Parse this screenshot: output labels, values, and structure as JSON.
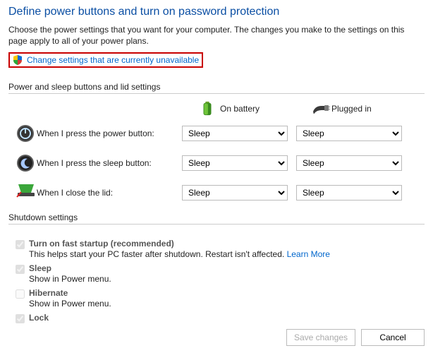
{
  "title": "Define power buttons and turn on password protection",
  "intro": "Choose the power settings that you want for your computer. The changes you make to the settings on this page apply to all of your power plans.",
  "change_link": "Change settings that are currently unavailable",
  "section_power": "Power and sleep buttons and lid settings",
  "cols": {
    "battery": "On battery",
    "plugged": "Plugged in"
  },
  "rows": {
    "power": {
      "label": "When I press the power button:",
      "battery": "Sleep",
      "plugged": "Sleep"
    },
    "sleep": {
      "label": "When I press the sleep button:",
      "battery": "Sleep",
      "plugged": "Sleep"
    },
    "lid": {
      "label": "When I close the lid:",
      "battery": "Sleep",
      "plugged": "Sleep"
    }
  },
  "section_shutdown": "Shutdown settings",
  "shutdown": {
    "fast": {
      "title": "Turn on fast startup (recommended)",
      "desc": "This helps start your PC faster after shutdown. Restart isn't affected. ",
      "learn": "Learn More"
    },
    "sleep": {
      "title": "Sleep",
      "desc": "Show in Power menu."
    },
    "hibernate": {
      "title": "Hibernate",
      "desc": "Show in Power menu."
    },
    "lock": {
      "title": "Lock"
    }
  },
  "buttons": {
    "save": "Save changes",
    "cancel": "Cancel"
  }
}
